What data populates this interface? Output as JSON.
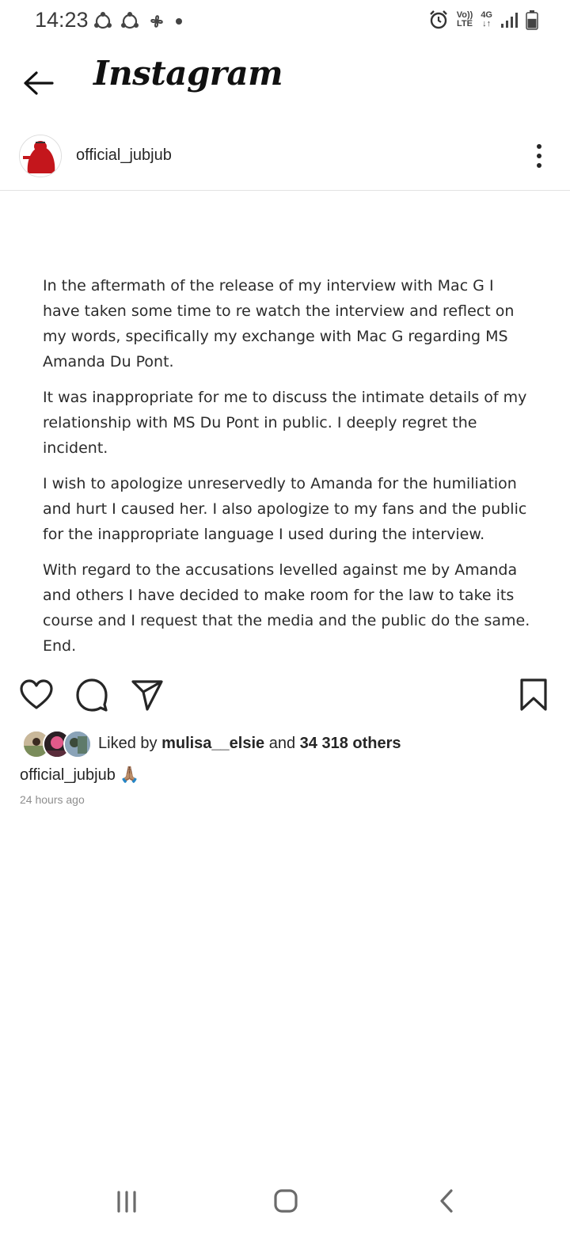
{
  "status_bar": {
    "time": "14:23",
    "network_top": "Vo))",
    "network_bottom": "LTE",
    "data_top": "4G",
    "data_bottom": "↓↑",
    "battery_level": 0.6
  },
  "header": {
    "title": "Instagram"
  },
  "post": {
    "username": "official_jubjub",
    "paragraphs": [
      "In the aftermath of the release of my interview with Mac G I have taken some time to re watch the interview and reflect on my words, specifically my exchange with Mac G regarding MS Amanda Du Pont.",
      "It was inappropriate for me to discuss the intimate details of my relationship with MS Du Pont in public. I deeply regret the incident.",
      "I wish to apologize unreservedly to Amanda for the humiliation and hurt I caused her. I also apologize to my fans and the public for the inappropriate language I used during the interview.",
      "With regard to the accusations levelled against me by Amanda and others I have decided to make room for the law to take its course and I request that the media and the public do the same. End."
    ],
    "likes_prefix": "Liked by",
    "likes_user": "mulisa__elsie",
    "likes_and": "and",
    "likes_others": "34 318 others",
    "caption_user": "official_jubjub",
    "caption_text": "🙏🏽",
    "timestamp": "24 hours ago"
  },
  "colors": {
    "accent_red": "#c4161c",
    "text": "#262626",
    "muted": "#8e8e8e"
  }
}
